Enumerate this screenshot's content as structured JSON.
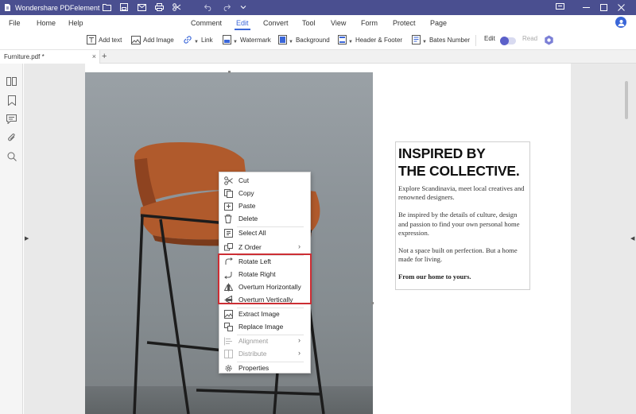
{
  "titlebar": {
    "app_title": "Wondershare PDFelement"
  },
  "menu": {
    "file": "File",
    "home": "Home",
    "help": "Help",
    "comment": "Comment",
    "edit": "Edit",
    "convert": "Convert",
    "tool": "Tool",
    "view": "View",
    "form": "Form",
    "protect": "Protect",
    "page": "Page"
  },
  "toolbar": {
    "add_text": "Add text",
    "add_image": "Add Image",
    "link": "Link",
    "watermark": "Watermark",
    "background": "Background",
    "header_footer": "Header & Footer",
    "bates_number": "Bates Number",
    "edit_label": "Edit",
    "read_label": "Read"
  },
  "tab": {
    "name": "Furniture.pdf *",
    "close": "×",
    "add": "+"
  },
  "textbox": {
    "heading_line1": "INSPIRED BY",
    "heading_line2": "THE COLLECTIVE.",
    "para1": "Explore Scandinavia, meet local creatives and renowned designers.",
    "para2": "Be inspired by the details of culture, design and passion to find your own personal home expression.",
    "para3": "Not a space built on perfection. But a home made for living.",
    "para4": "From our home to yours."
  },
  "context_menu": {
    "cut": "Cut",
    "copy": "Copy",
    "paste": "Paste",
    "delete": "Delete",
    "select_all": "Select All",
    "z_order": "Z Order",
    "rotate_left": "Rotate Left",
    "rotate_right": "Rotate Right",
    "overturn_h": "Overturn Horizontally",
    "overturn_v": "Overturn Vertically",
    "extract_image": "Extract Image",
    "replace_image": "Replace Image",
    "alignment": "Alignment",
    "distribute": "Distribute",
    "properties": "Properties"
  },
  "colors": {
    "titlebar": "#4a4f90",
    "accent": "#3a66d8",
    "toggle_knob": "#5b60c9",
    "highlight_box": "#cc2e34",
    "chair_seat": "#b05a2c"
  }
}
